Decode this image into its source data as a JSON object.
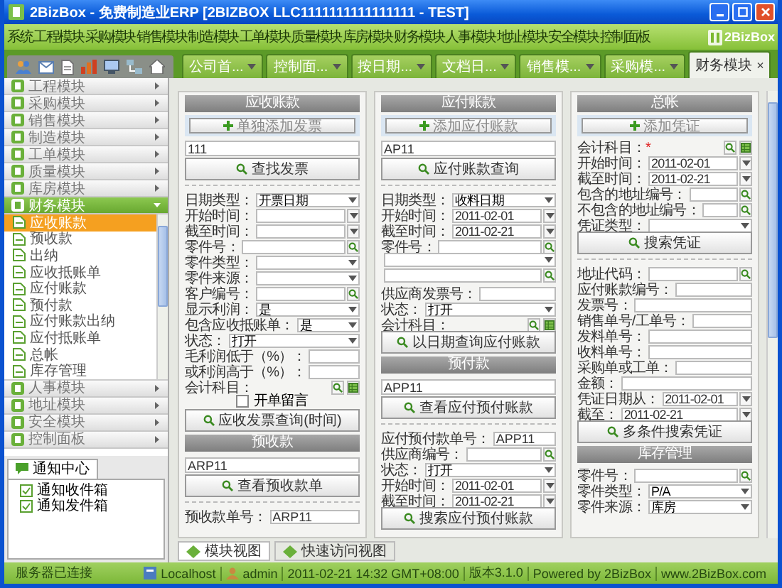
{
  "window": {
    "title": "2BizBox - 免费制造业ERP [2BIZBOX LLC1111111111111111 - TEST]"
  },
  "menu": [
    "系统",
    "工程模块",
    "采购模块",
    "销售模块",
    "制造模块",
    "工单模块",
    "质量模块",
    "库房模块",
    "财务模块",
    "人事模块",
    "地址模块",
    "安全模块",
    "控制面板"
  ],
  "logo": {
    "name": "2BizBox"
  },
  "tabs": [
    {
      "label": "公司首...",
      "selected": false
    },
    {
      "label": "控制面...",
      "selected": false
    },
    {
      "label": "按日期...",
      "selected": false
    },
    {
      "label": "文档日...",
      "selected": false
    },
    {
      "label": "销售模...",
      "selected": false
    },
    {
      "label": "采购模...",
      "selected": false
    },
    {
      "label": "财务模块",
      "selected": true,
      "close": "×"
    }
  ],
  "sidebar": {
    "items": [
      {
        "label": "工程模块",
        "expanded": false
      },
      {
        "label": "采购模块",
        "expanded": false
      },
      {
        "label": "销售模块",
        "expanded": false
      },
      {
        "label": "制造模块",
        "expanded": false
      },
      {
        "label": "工单模块",
        "expanded": false
      },
      {
        "label": "质量模块",
        "expanded": false
      },
      {
        "label": "库房模块",
        "expanded": false
      },
      {
        "label": "财务模块",
        "expanded": true,
        "children": [
          {
            "label": "应收账款",
            "selected": true
          },
          {
            "label": "预收款",
            "selected": false
          },
          {
            "label": "出纳",
            "selected": false
          },
          {
            "label": "应收抵账单",
            "selected": false
          },
          {
            "label": "应付账款",
            "selected": false
          },
          {
            "label": "预付款",
            "selected": false
          },
          {
            "label": "应付账款出纳",
            "selected": false
          },
          {
            "label": "应付抵账单",
            "selected": false
          },
          {
            "label": "总帐",
            "selected": false
          },
          {
            "label": "库存管理",
            "selected": false
          }
        ]
      },
      {
        "label": "人事模块",
        "expanded": false
      },
      {
        "label": "地址模块",
        "expanded": false
      },
      {
        "label": "安全模块",
        "expanded": false
      },
      {
        "label": "控制面板",
        "expanded": false
      }
    ]
  },
  "notification_center": {
    "title": "通知中心",
    "items": [
      "通知收件箱",
      "通知发件箱"
    ]
  },
  "columns": [
    {
      "sections": [
        {
          "title": "应收账款",
          "rows": [
            {
              "kind": "add",
              "label": "单独添加发票"
            },
            {
              "kind": "input",
              "value": "111"
            },
            {
              "kind": "search",
              "label": "查找发票"
            },
            {
              "kind": "divider"
            },
            {
              "kind": "select",
              "label": "日期类型：",
              "value": "开票日期"
            },
            {
              "kind": "date",
              "label": "开始时间："
            },
            {
              "kind": "date",
              "label": "截至时间："
            },
            {
              "kind": "lookup",
              "label": "零件号："
            },
            {
              "kind": "select",
              "label": "零件类型："
            },
            {
              "kind": "select",
              "label": "零件来源："
            },
            {
              "kind": "lookup",
              "label": "客户编号："
            },
            {
              "kind": "select",
              "label": "显示利润：",
              "value": "是"
            },
            {
              "kind": "select",
              "label": "包含应收抵账单：",
              "value": "是"
            },
            {
              "kind": "select",
              "label": "状态：",
              "value": "打开"
            },
            {
              "kind": "text",
              "label": "毛利润低于（%）："
            },
            {
              "kind": "text",
              "label": "或利润高于（%）："
            },
            {
              "kind": "icons",
              "label": "会计科目："
            },
            {
              "kind": "checkbox",
              "label": "开单留言",
              "checked": false
            },
            {
              "kind": "search",
              "label": "应收发票查询(时间)"
            }
          ]
        },
        {
          "title": "预收款",
          "rows": [
            {
              "kind": "input",
              "value": "ARP11"
            },
            {
              "kind": "search",
              "label": "查看预收款单"
            },
            {
              "kind": "divider"
            },
            {
              "kind": "text",
              "label": "预收款单号：",
              "value": "ARP11"
            }
          ]
        }
      ]
    },
    {
      "sections": [
        {
          "title": "应付账款",
          "rows": [
            {
              "kind": "add",
              "label": "添加应付账款"
            },
            {
              "kind": "input",
              "value": "AP11"
            },
            {
              "kind": "search",
              "label": "应付账款查询"
            },
            {
              "kind": "divider"
            },
            {
              "kind": "select",
              "label": "日期类型：",
              "value": "收料日期"
            },
            {
              "kind": "date",
              "label": "开始时间：",
              "value": "2011-02-01"
            },
            {
              "kind": "date",
              "label": "截至时间：",
              "value": "2011-02-21"
            },
            {
              "kind": "lookup",
              "label": "零件号："
            },
            {
              "kind": "select"
            },
            {
              "kind": "lookup"
            },
            {
              "kind": "text",
              "label": "供应商发票号："
            },
            {
              "kind": "select",
              "label": "状态：",
              "value": "打开"
            },
            {
              "kind": "icons",
              "label": "会计科目："
            },
            {
              "kind": "search",
              "label": "以日期查询应付账款"
            }
          ]
        },
        {
          "title": "预付款",
          "rows": [
            {
              "kind": "input",
              "value": "APP11"
            },
            {
              "kind": "search",
              "label": "查看应付预付账款"
            },
            {
              "kind": "divider"
            },
            {
              "kind": "text",
              "label": "应付预付款单号：",
              "value": "APP11"
            },
            {
              "kind": "lookup",
              "label": "供应商编号："
            },
            {
              "kind": "select",
              "label": "状态：",
              "value": "打开"
            },
            {
              "kind": "date",
              "label": "开始时间：",
              "value": "2011-02-01"
            },
            {
              "kind": "date",
              "label": "截至时间：",
              "value": "2011-02-21"
            },
            {
              "kind": "search",
              "label": "搜索应付预付账款"
            }
          ]
        }
      ]
    },
    {
      "sections": [
        {
          "title": "总帐",
          "rows": [
            {
              "kind": "add",
              "label": "添加凭证"
            },
            {
              "kind": "icons",
              "label": "会计科目：",
              "required_mark": "*"
            },
            {
              "kind": "date",
              "label": "开始时间：",
              "value": "2011-02-01"
            },
            {
              "kind": "date",
              "label": "截至时间：",
              "value": "2011-02-21"
            },
            {
              "kind": "lookup",
              "label": "包含的地址编号："
            },
            {
              "kind": "lookup",
              "label": "不包含的地址编号："
            },
            {
              "kind": "select",
              "label": "凭证类型："
            },
            {
              "kind": "search",
              "label": "搜索凭证"
            },
            {
              "kind": "divider"
            },
            {
              "kind": "lookup",
              "label": "地址代码："
            },
            {
              "kind": "text",
              "label": "应付账款编号："
            },
            {
              "kind": "text",
              "label": "发票号："
            },
            {
              "kind": "text",
              "label": "销售单号/工单号："
            },
            {
              "kind": "text",
              "label": "发料单号："
            },
            {
              "kind": "text",
              "label": "收料单号："
            },
            {
              "kind": "text",
              "label": "采购单或工单："
            },
            {
              "kind": "text",
              "label": "金额："
            },
            {
              "kind": "date",
              "label": "凭证日期从：",
              "value": "2011-02-01"
            },
            {
              "kind": "date",
              "label": "截至：",
              "value": "2011-02-21"
            },
            {
              "kind": "search",
              "label": "多条件搜索凭证"
            }
          ]
        },
        {
          "title": "库存管理",
          "rows": [
            {
              "kind": "lookup",
              "label": "零件号："
            },
            {
              "kind": "select",
              "label": "零件类型：",
              "value": "P/A"
            },
            {
              "kind": "select",
              "label": "零件来源：",
              "value": "库房"
            }
          ]
        }
      ]
    }
  ],
  "view_tabs": [
    {
      "label": "模块视图",
      "selected": true
    },
    {
      "label": "快速访问视图",
      "selected": false
    }
  ],
  "status_bar": {
    "connection": "服务器已连接",
    "server": "Localhost",
    "user": "admin",
    "time": "2011-02-21 14:32 GMT+08:00",
    "version": "版本3.1.0",
    "powered": "Powered by 2BizBox",
    "website": "www.2BizBox.com"
  }
}
